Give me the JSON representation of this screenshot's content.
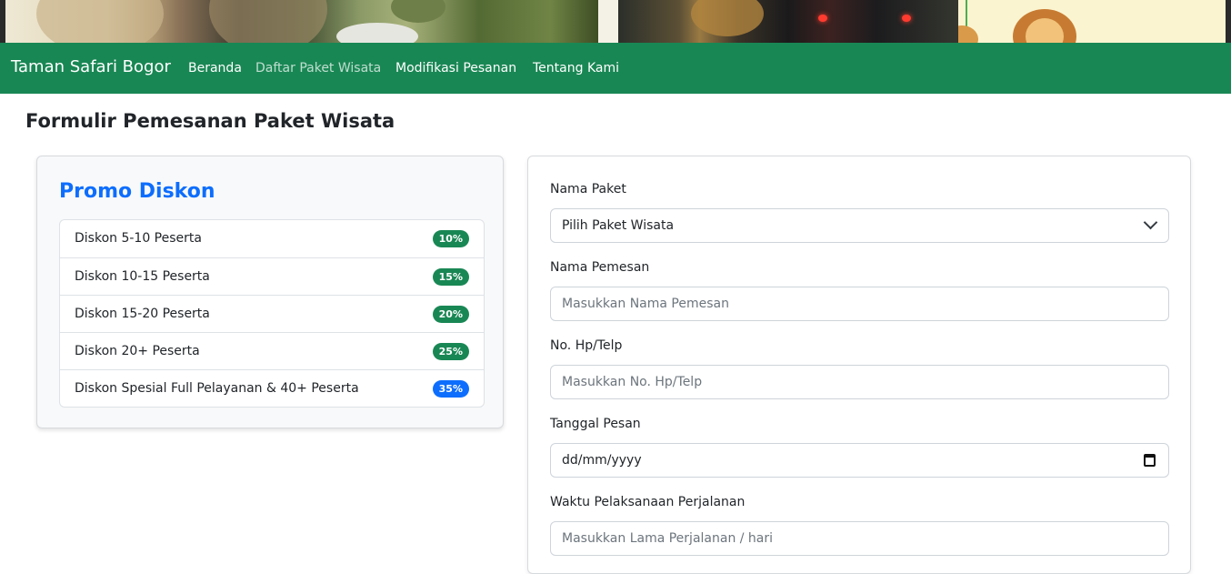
{
  "navbar": {
    "brand": "Taman Safari Bogor",
    "links": [
      {
        "label": "Beranda"
      },
      {
        "label": "Daftar Paket Wisata"
      },
      {
        "label": "Modifikasi Pesanan"
      },
      {
        "label": "Tentang Kami"
      }
    ]
  },
  "page": {
    "title": "Formulir Pemesanan Paket Wisata"
  },
  "promo": {
    "title": "Promo Diskon",
    "items": [
      {
        "label": "Diskon 5-10 Peserta",
        "badge": "10%",
        "badge_color": "#198754"
      },
      {
        "label": "Diskon 10-15 Peserta",
        "badge": "15%",
        "badge_color": "#198754"
      },
      {
        "label": "Diskon 15-20 Peserta",
        "badge": "20%",
        "badge_color": "#198754"
      },
      {
        "label": "Diskon 20+ Peserta",
        "badge": "25%",
        "badge_color": "#198754"
      },
      {
        "label": "Diskon Spesial Full Pelayanan & 40+ Peserta",
        "badge": "35%",
        "badge_color": "#0d6efd"
      }
    ]
  },
  "form": {
    "paket": {
      "label": "Nama Paket",
      "selected": "Pilih Paket Wisata"
    },
    "pemesan": {
      "label": "Nama Pemesan",
      "placeholder": "Masukkan Nama Pemesan"
    },
    "telp": {
      "label": "No. Hp/Telp",
      "placeholder": "Masukkan No. Hp/Telp"
    },
    "tanggal": {
      "label": "Tanggal Pesan",
      "value": "dd/mm/yyyy"
    },
    "waktu": {
      "label": "Waktu Pelaksanaan Perjalanan",
      "placeholder": "Masukkan Lama Perjalanan / hari"
    }
  },
  "colors": {
    "navbar": "#198754",
    "promo_title": "#0d6efd",
    "badge_green": "#198754",
    "badge_blue": "#0d6efd"
  }
}
